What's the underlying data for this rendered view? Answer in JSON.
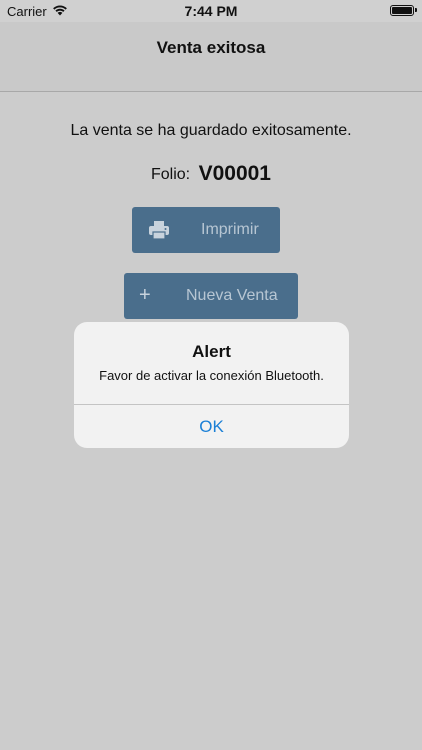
{
  "status_bar": {
    "carrier": "Carrier",
    "time": "7:44 PM",
    "wifi_icon": "wifi-icon",
    "battery_icon": "battery-icon"
  },
  "nav_bar": {
    "title": "Venta exitosa"
  },
  "content": {
    "message": "La venta se ha guardado exitosamente.",
    "folio_label": "Folio:",
    "folio_value": "V00001",
    "print_button": {
      "label": "Imprimir",
      "icon": "printer-icon"
    },
    "new_sale_button": {
      "label": "Nueva Venta",
      "icon": "plus-icon"
    },
    "button_color": "#4a6e8c"
  },
  "alert": {
    "title": "Alert",
    "message": "Favor de activar la conexión Bluetooth.",
    "ok_label": "OK",
    "ok_color": "#1a7fd6"
  }
}
